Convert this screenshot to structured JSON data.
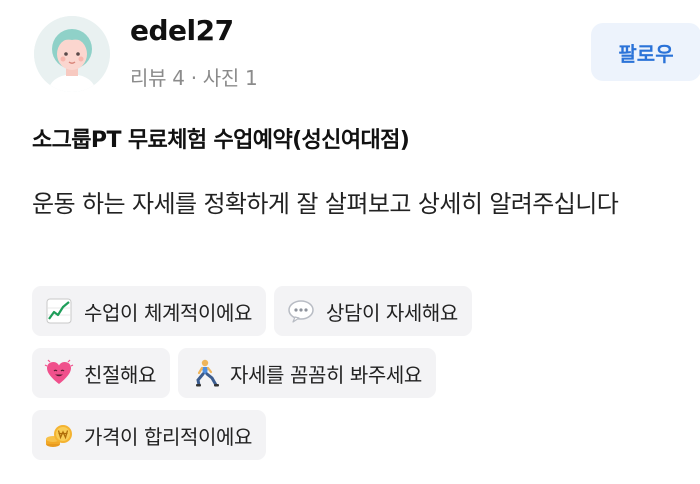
{
  "user": {
    "name": "edel27",
    "meta_reviews": "리뷰 4",
    "meta_sep": "·",
    "meta_photos": "사진 1"
  },
  "follow_button": {
    "label": "팔로우",
    "color": "#2b73d8",
    "background": "#edf3fc"
  },
  "place": {
    "title": "소그룹PT 무료체험 수업예약(성신여대점)"
  },
  "review": {
    "text": "운동 하는 자세를 정확하게 잘 살펴보고 상세히 알려주십니다"
  },
  "tags": [
    {
      "label": "수업이 체계적이에요",
      "icon": "chart-increasing-icon"
    },
    {
      "label": "상담이 자세해요",
      "icon": "speech-bubble-icon"
    },
    {
      "label": "친절해요",
      "icon": "heart-icon"
    },
    {
      "label": "자세를 꼼꼼히 봐주세요",
      "icon": "lunge-person-icon"
    },
    {
      "label": "가격이 합리적이에요",
      "icon": "coins-icon"
    }
  ]
}
